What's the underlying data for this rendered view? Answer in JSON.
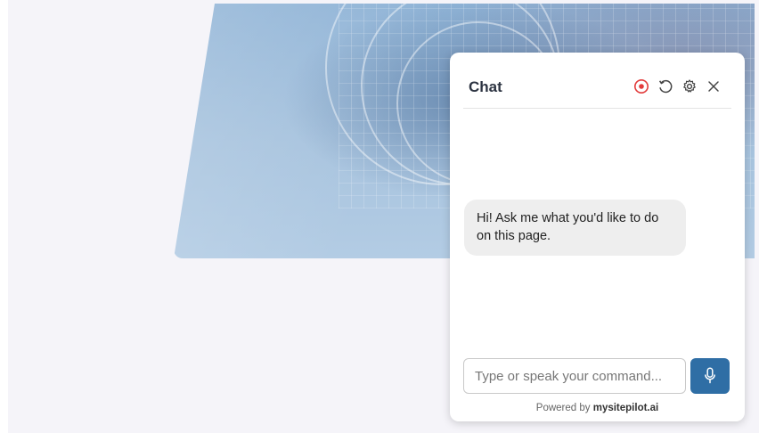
{
  "chat": {
    "title": "Chat",
    "greeting": "Hi! Ask me what you'd like to do on this page.",
    "input_placeholder": "Type or speak your command...",
    "powered_prefix": "Powered by",
    "powered_brand": "mysitepilot.ai",
    "header_icons": [
      "record-icon",
      "reset-icon",
      "settings-icon",
      "close-icon"
    ]
  },
  "colors": {
    "accent": "#2f6ea5",
    "record": "#e23b3b",
    "page_background": "#f5f4f9",
    "bubble": "#eeeeee"
  }
}
